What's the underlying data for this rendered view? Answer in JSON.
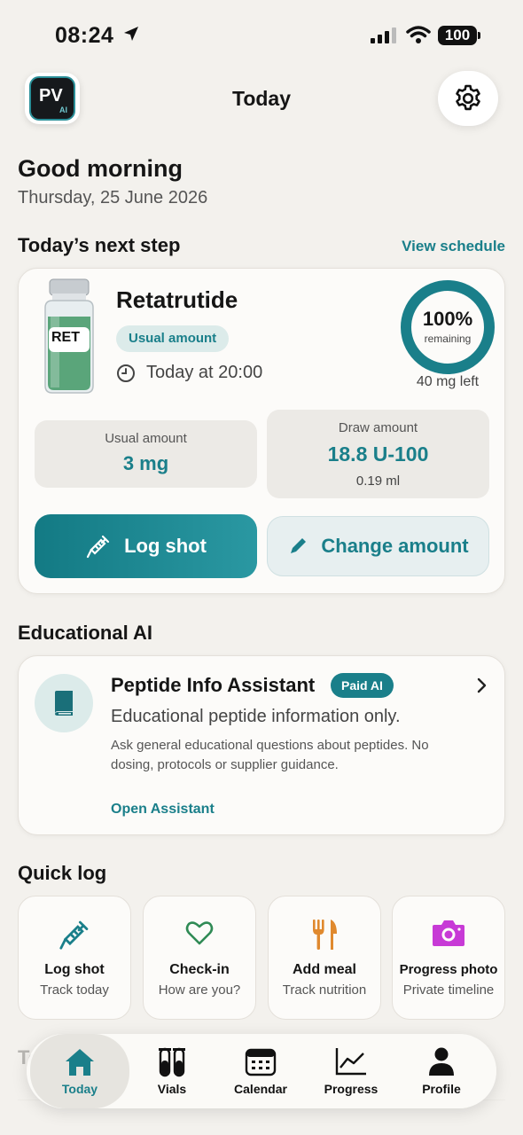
{
  "status_bar": {
    "time": "08:24",
    "battery": "100"
  },
  "header": {
    "title": "Today",
    "logo_text": "PV",
    "logo_badge": "AI",
    "settings_icon": "gear-icon"
  },
  "greeting": {
    "title": "Good morning",
    "date": "Thursday, 25 June 2026"
  },
  "next_step": {
    "section_title": "Today’s next step",
    "view_schedule": "View schedule",
    "vial_label": "RET",
    "drug_name": "Retatrutide",
    "pill": "Usual amount",
    "time": "Today at 20:00",
    "remaining_pct": "100%",
    "remaining_label": "remaining",
    "remaining_fraction": 1.0,
    "mg_left": "40 mg left",
    "usual_label": "Usual amount",
    "usual_value": "3 mg",
    "draw_label": "Draw amount",
    "draw_value": "18.8 U-100",
    "draw_ml": "0.19 ml",
    "log_shot": "Log shot",
    "change_amount": "Change amount",
    "accent": "#1a7f8a"
  },
  "educational": {
    "section_title": "Educational AI",
    "title": "Peptide Info Assistant",
    "badge": "Paid AI",
    "subtitle": "Educational peptide information only.",
    "description": "Ask general educational questions about peptides. No dosing, protocols or supplier guidance.",
    "link": "Open Assistant"
  },
  "quick_log": {
    "section_title": "Quick log",
    "items": [
      {
        "title": "Log shot",
        "subtitle": "Track today",
        "icon": "syringe-icon"
      },
      {
        "title": "Check-in",
        "subtitle": "How are you?",
        "icon": "heart-icon"
      },
      {
        "title": "Add meal",
        "subtitle": "Track nutrition",
        "icon": "fork-knife-icon"
      },
      {
        "title": "Progress photo",
        "subtitle": "Private timeline",
        "icon": "camera-icon"
      }
    ]
  },
  "ghost_section": "To",
  "tabs": [
    {
      "label": "Today",
      "icon": "home-icon",
      "active": true
    },
    {
      "label": "Vials",
      "icon": "vials-icon"
    },
    {
      "label": "Calendar",
      "icon": "calendar-icon"
    },
    {
      "label": "Progress",
      "icon": "chart-icon"
    },
    {
      "label": "Profile",
      "icon": "person-icon"
    }
  ]
}
